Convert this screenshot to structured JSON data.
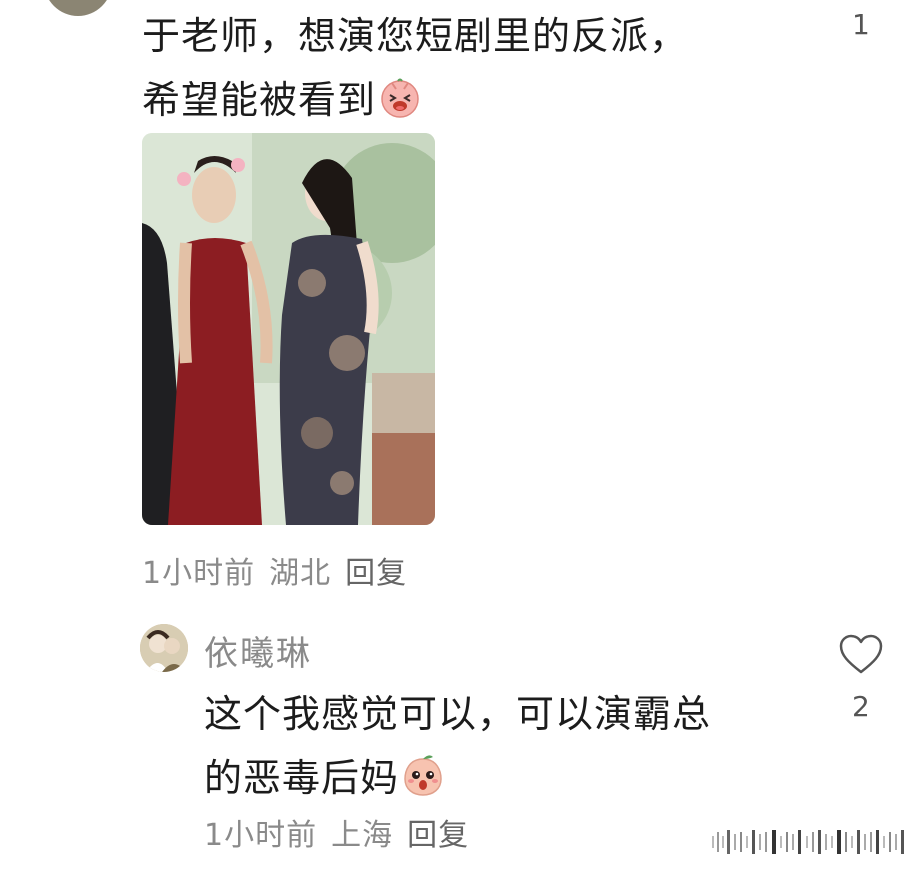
{
  "comment1": {
    "text_line1": "于老师，想演您短剧里的反派，",
    "text_line2": "希望能被看到",
    "emoji_icon": "laughing-pig-emoji",
    "like_count": "1",
    "time": "1小时前",
    "location": "湖北",
    "reply_label": "回复"
  },
  "reply1": {
    "username": "依曦琳",
    "text_line1": "这个我感觉可以，可以演霸总",
    "text_line2": "的恶毒后妈",
    "emoji_icon": "surprised-peach-emoji",
    "like_icon": "heart-outline-icon",
    "like_count": "2",
    "time": "1小时前",
    "location": "上海",
    "reply_label": "回复"
  },
  "colors": {
    "text": "#1c1c1c",
    "meta": "#8a8a8a",
    "background": "#ffffff"
  }
}
